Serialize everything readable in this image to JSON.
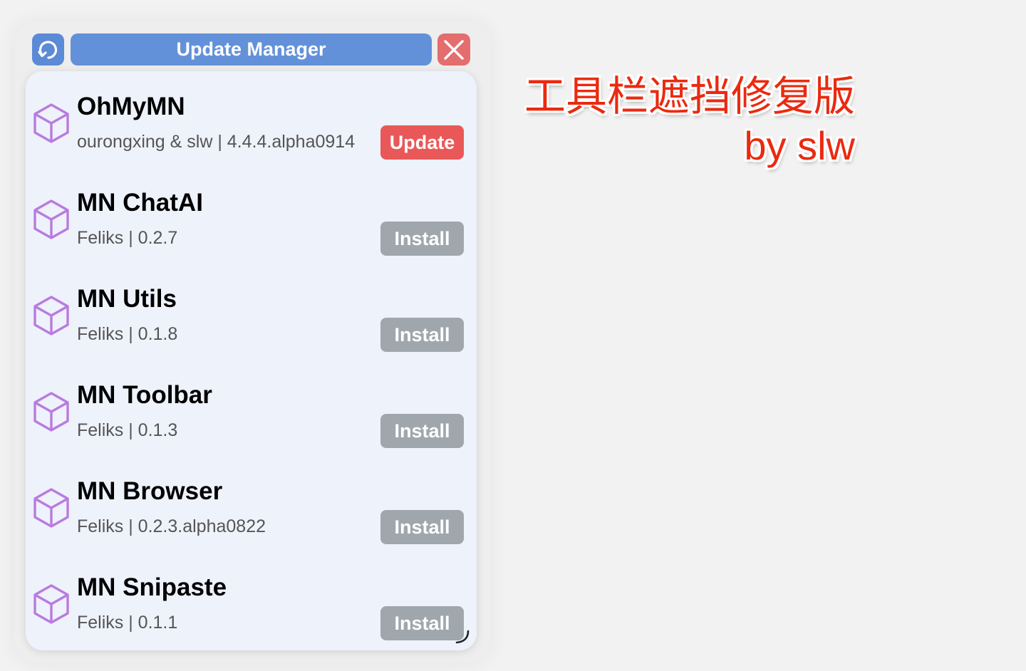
{
  "window": {
    "title": "Update Manager",
    "refresh_icon": "refresh-icon",
    "close_icon": "close-icon"
  },
  "colors": {
    "title_bar": "#6391d9",
    "refresh_button": "#5b8bd6",
    "close_button": "#e46d6d",
    "panel_background": "#eef2fb",
    "update_button": "#e95858",
    "install_button": "#9fa7ad",
    "cube_icon": "#b97be0",
    "annotation_text": "#ea2a10"
  },
  "addons": [
    {
      "name": "OhMyMN",
      "meta": "ourongxing & slw | 4.4.4.alpha0914",
      "action": "Update",
      "action_type": "update",
      "icon": "cube-icon"
    },
    {
      "name": "MN ChatAI",
      "meta": "Feliks | 0.2.7",
      "action": "Install",
      "action_type": "install",
      "icon": "cube-icon"
    },
    {
      "name": "MN Utils",
      "meta": "Feliks | 0.1.8",
      "action": "Install",
      "action_type": "install",
      "icon": "cube-icon"
    },
    {
      "name": "MN Toolbar",
      "meta": "Feliks | 0.1.3",
      "action": "Install",
      "action_type": "install",
      "icon": "cube-icon"
    },
    {
      "name": "MN Browser",
      "meta": "Feliks | 0.2.3.alpha0822",
      "action": "Install",
      "action_type": "install",
      "icon": "cube-icon"
    },
    {
      "name": "MN Snipaste",
      "meta": "Feliks | 0.1.1",
      "action": "Install",
      "action_type": "install",
      "icon": "cube-icon"
    }
  ],
  "annotation": {
    "line1": "工具栏遮挡修复版",
    "line2": "by slw"
  }
}
